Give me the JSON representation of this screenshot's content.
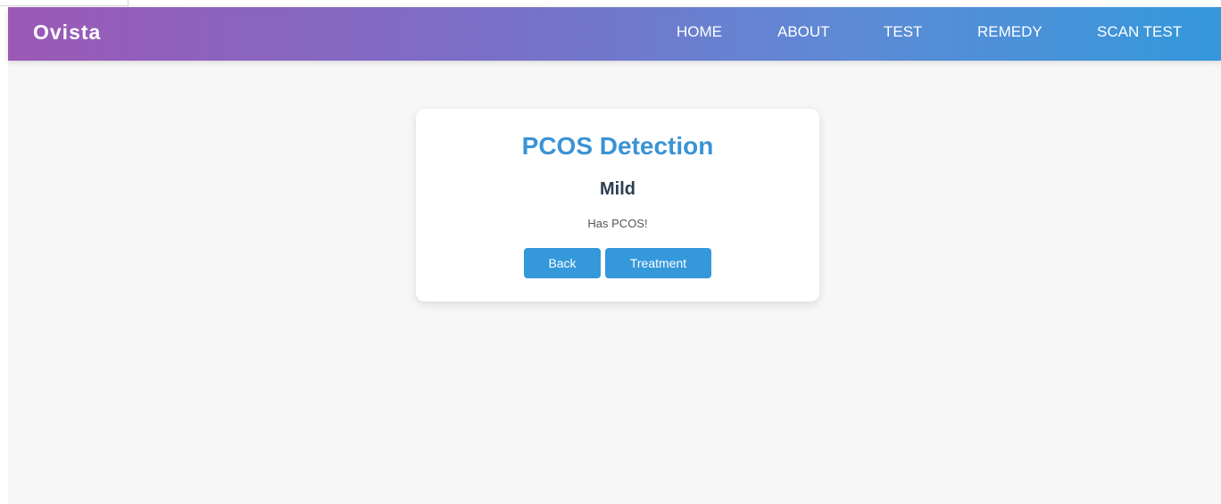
{
  "navbar": {
    "logo": "Ovista",
    "links": [
      "HOME",
      "ABOUT",
      "TEST",
      "REMEDY",
      "SCAN TEST"
    ]
  },
  "result_card": {
    "title": "PCOS Detection",
    "severity": "Mild",
    "message": "Has PCOS!",
    "back_label": "Back",
    "treatment_label": "Treatment"
  },
  "colors": {
    "nav_gradient_start": "#9b59b6",
    "nav_gradient_end": "#3498db",
    "title": "#3a93d6",
    "button": "#3498db",
    "severity_text": "#2c3e50",
    "page_background": "#f7f7f7"
  }
}
